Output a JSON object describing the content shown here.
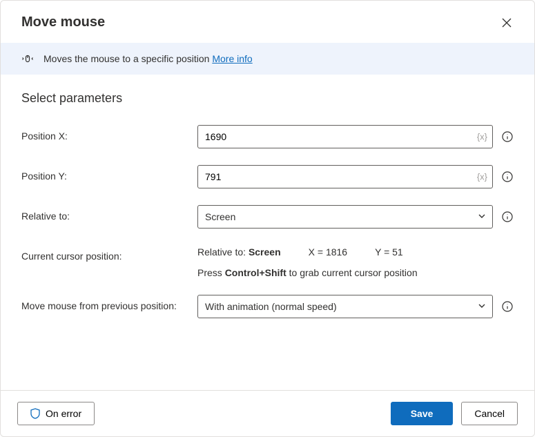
{
  "header": {
    "title": "Move mouse"
  },
  "banner": {
    "text": "Moves the mouse to a specific position ",
    "link": "More info"
  },
  "section_title": "Select parameters",
  "fields": {
    "posx": {
      "label": "Position X:",
      "value": "1690",
      "var_hint": "{x}"
    },
    "posy": {
      "label": "Position Y:",
      "value": "791",
      "var_hint": "{x}"
    },
    "relative": {
      "label": "Relative to:",
      "value": "Screen"
    },
    "cursor": {
      "label": "Current cursor position:",
      "relative_label": "Relative to:",
      "relative_value": "Screen",
      "x_label": "X =",
      "x_value": "1816",
      "y_label": "Y =",
      "y_value": "51",
      "hint_before": "Press ",
      "hint_keys": "Control+Shift",
      "hint_after": " to grab current cursor position"
    },
    "movefrom": {
      "label": "Move mouse from previous position:",
      "value": "With animation (normal speed)"
    }
  },
  "footer": {
    "on_error": "On error",
    "save": "Save",
    "cancel": "Cancel"
  }
}
